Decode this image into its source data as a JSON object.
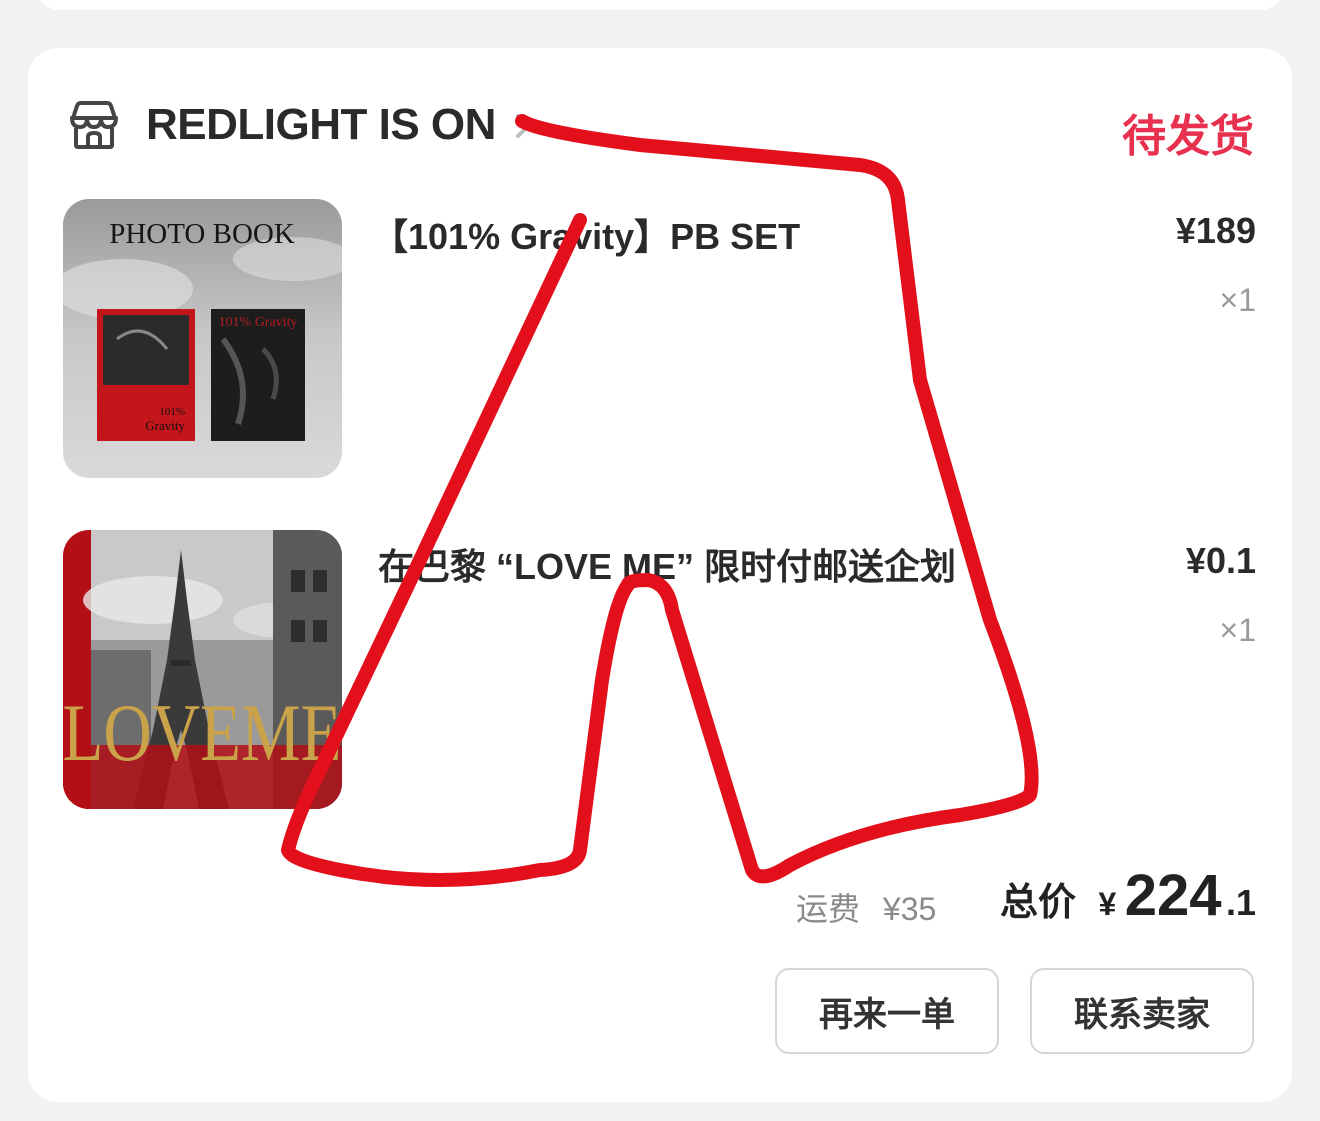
{
  "order": {
    "store_name": "REDLIGHT IS ON",
    "status": "待发货",
    "items": [
      {
        "title": "【101% Gravity】PB SET",
        "price": "¥189",
        "qty": "×1",
        "thumb_text": "PHOTO BOOK",
        "thumb_cover_text": "101% Gravity"
      },
      {
        "title": "在巴黎 “LOVE ME” 限时付邮送企划",
        "price": "¥0.1",
        "qty": "×1",
        "thumb_text": "LOVEME"
      }
    ],
    "shipping_label": "运费",
    "shipping_value": "¥35",
    "total_label": "总价",
    "total_currency": "¥",
    "total_int": "224",
    "total_dec": ".1",
    "buttons": {
      "reorder": "再来一单",
      "contact": "联系卖家"
    }
  },
  "colors": {
    "status": "#e8304f",
    "annotation": "#e3101b"
  }
}
